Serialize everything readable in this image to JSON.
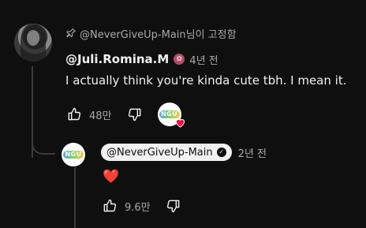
{
  "pinned": {
    "icon": "pin-icon",
    "text": "@NeverGiveUp-Main님이 고정함"
  },
  "comment": {
    "author": "@Juli.Romina.M",
    "member_badge_icon": "member-badge-icon",
    "time": "4년 전",
    "text": "I actually think you're kinda cute tbh. I mean it.",
    "like_count": "48만",
    "hearted": true,
    "heart_color": "#ff0033"
  },
  "reply": {
    "author": "@NeverGiveUp-Main",
    "verified_icon": "check-icon",
    "time": "2년 전",
    "text": "❤️",
    "like_count": "9.6만"
  },
  "colors": {
    "background": "#0f0f0f",
    "primary_text": "#f1f1f1",
    "secondary_text": "#aaaaaa",
    "thread_line": "#3b3b3b",
    "owner_chip": "#f1f1f1"
  }
}
